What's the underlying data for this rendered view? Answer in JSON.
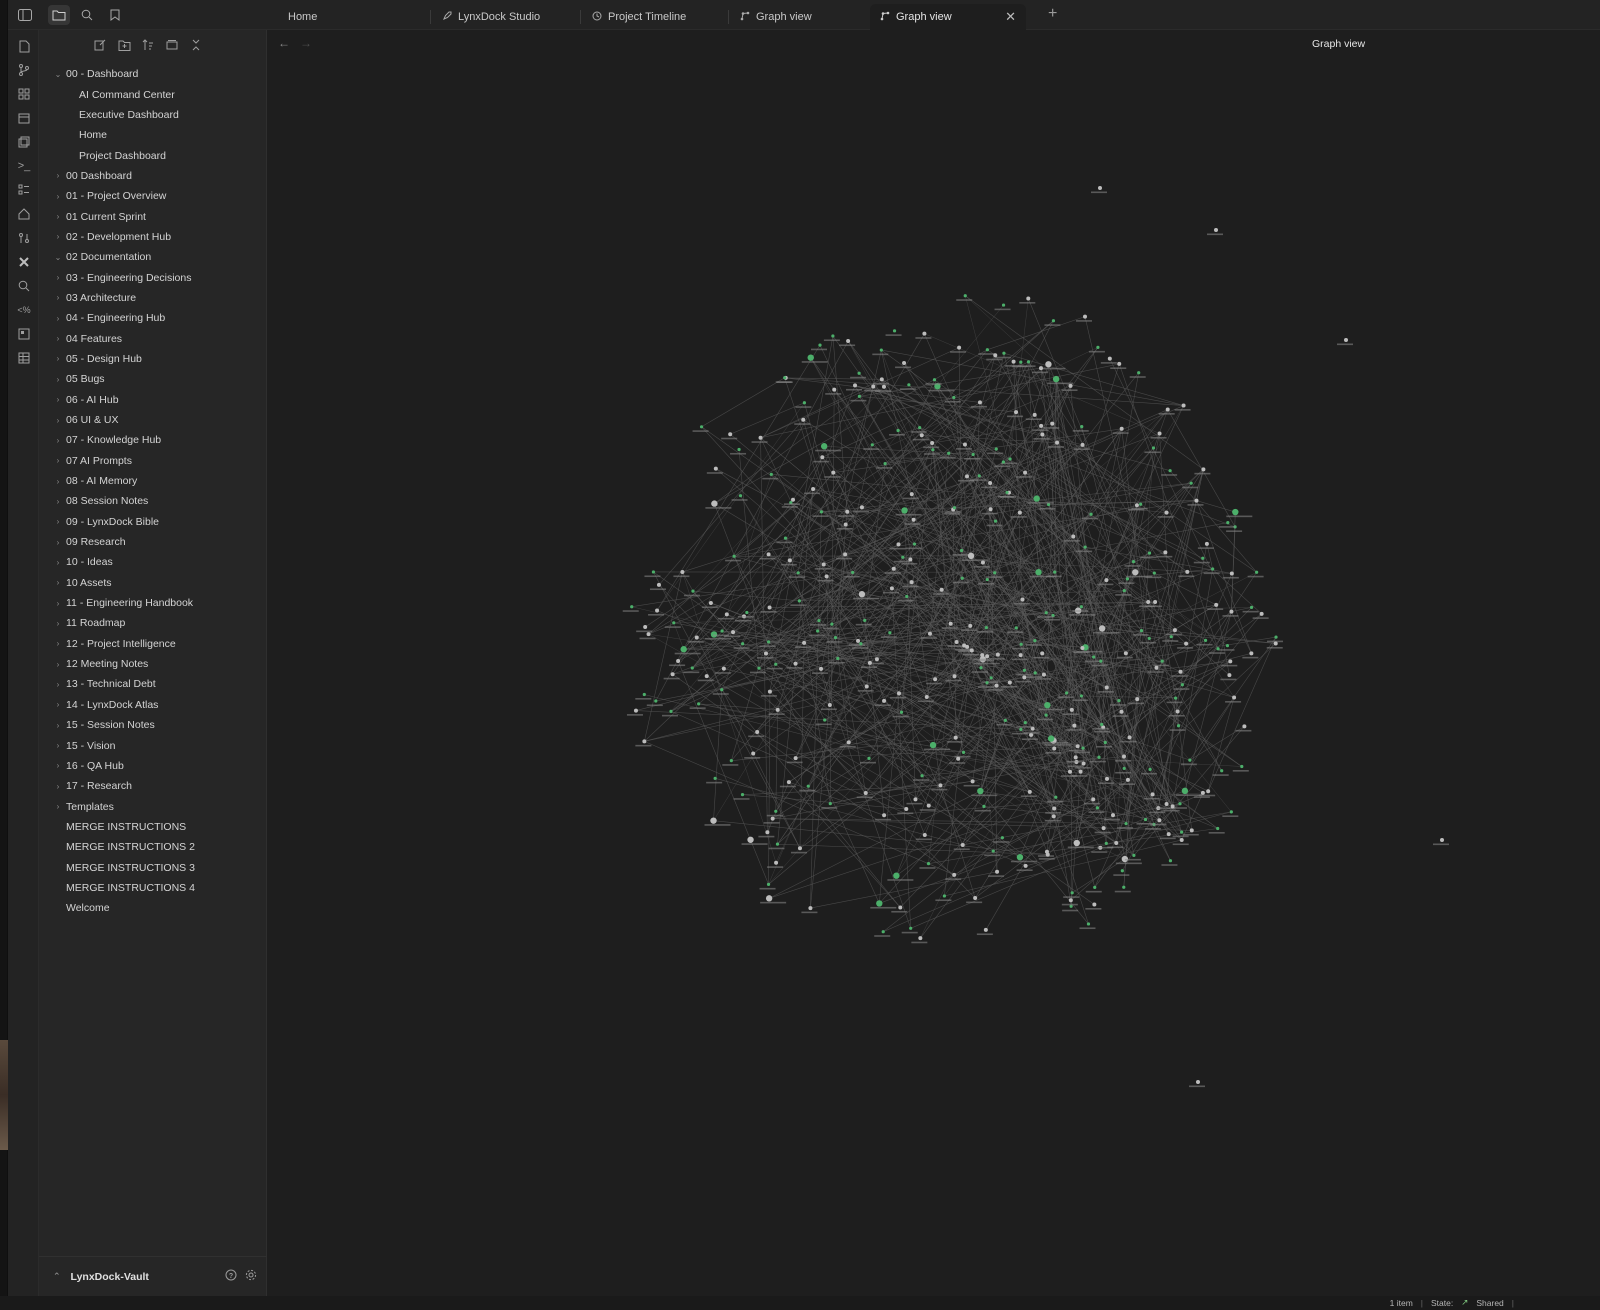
{
  "tabs": [
    {
      "label": "Home",
      "icon": "none"
    },
    {
      "label": "LynxDock Studio",
      "icon": "rocket-icon"
    },
    {
      "label": "Project Timeline",
      "icon": "history-icon"
    },
    {
      "label": "Graph view",
      "icon": "graph-icon"
    },
    {
      "label": "Graph view",
      "icon": "graph-icon",
      "active": true
    }
  ],
  "main": {
    "view_title": "Graph view"
  },
  "sidebar": {
    "items": [
      {
        "label": "00 - Dashboard",
        "type": "folder-open"
      },
      {
        "label": "AI Command Center",
        "type": "child"
      },
      {
        "label": "Executive Dashboard",
        "type": "child"
      },
      {
        "label": "Home",
        "type": "child"
      },
      {
        "label": "Project Dashboard",
        "type": "child"
      },
      {
        "label": "00 Dashboard",
        "type": "folder"
      },
      {
        "label": "01 - Project Overview",
        "type": "folder"
      },
      {
        "label": "01 Current Sprint",
        "type": "folder"
      },
      {
        "label": "02 - Development Hub",
        "type": "folder"
      },
      {
        "label": "02 Documentation",
        "type": "folder-open"
      },
      {
        "label": "03 - Engineering Decisions",
        "type": "folder"
      },
      {
        "label": "03 Architecture",
        "type": "folder"
      },
      {
        "label": "04 - Engineering Hub",
        "type": "folder"
      },
      {
        "label": "04 Features",
        "type": "folder"
      },
      {
        "label": "05 - Design Hub",
        "type": "folder"
      },
      {
        "label": "05 Bugs",
        "type": "folder"
      },
      {
        "label": "06 - AI Hub",
        "type": "folder"
      },
      {
        "label": "06 UI & UX",
        "type": "folder"
      },
      {
        "label": "07 - Knowledge Hub",
        "type": "folder"
      },
      {
        "label": "07 AI Prompts",
        "type": "folder"
      },
      {
        "label": "08 - AI Memory",
        "type": "folder"
      },
      {
        "label": "08 Session Notes",
        "type": "folder"
      },
      {
        "label": "09 - LynxDock Bible",
        "type": "folder"
      },
      {
        "label": "09 Research",
        "type": "folder"
      },
      {
        "label": "10 - Ideas",
        "type": "folder"
      },
      {
        "label": "10 Assets",
        "type": "folder"
      },
      {
        "label": "11 - Engineering Handbook",
        "type": "folder"
      },
      {
        "label": "11 Roadmap",
        "type": "folder"
      },
      {
        "label": "12 - Project Intelligence",
        "type": "folder"
      },
      {
        "label": "12 Meeting Notes",
        "type": "folder"
      },
      {
        "label": "13 - Technical Debt",
        "type": "folder"
      },
      {
        "label": "14 - LynxDock Atlas",
        "type": "folder"
      },
      {
        "label": "15 - Session Notes",
        "type": "folder"
      },
      {
        "label": "15 - Vision",
        "type": "folder"
      },
      {
        "label": "16 - QA Hub",
        "type": "folder"
      },
      {
        "label": "17 - Research",
        "type": "folder"
      },
      {
        "label": "Templates",
        "type": "folder"
      },
      {
        "label": "MERGE INSTRUCTIONS",
        "type": "file"
      },
      {
        "label": "MERGE INSTRUCTIONS 2",
        "type": "file"
      },
      {
        "label": "MERGE INSTRUCTIONS 3",
        "type": "file"
      },
      {
        "label": "MERGE INSTRUCTIONS 4",
        "type": "file"
      },
      {
        "label": "Welcome",
        "type": "file"
      }
    ],
    "vault_name": "LynxDock-Vault"
  },
  "status": {
    "items": "1 item",
    "state_label": "State:",
    "state_value": "Shared"
  },
  "colors": {
    "background": "#1e1e1e",
    "sidebar": "#262626",
    "node_note": "#bdbdbd",
    "node_tag": "#4caf6a",
    "edge": "#5a5a5a",
    "accent_shared": "#7fc97f"
  },
  "ribbon_icons": [
    "file-icon",
    "git-branch-icon",
    "grid-icon",
    "calendar-icon",
    "copy-icon",
    "terminal-icon",
    "list-icon",
    "home-icon",
    "git-compare-icon",
    "tools-icon",
    "search-icon",
    "code-percent-icon",
    "dashboard-icon",
    "table-icon"
  ]
}
